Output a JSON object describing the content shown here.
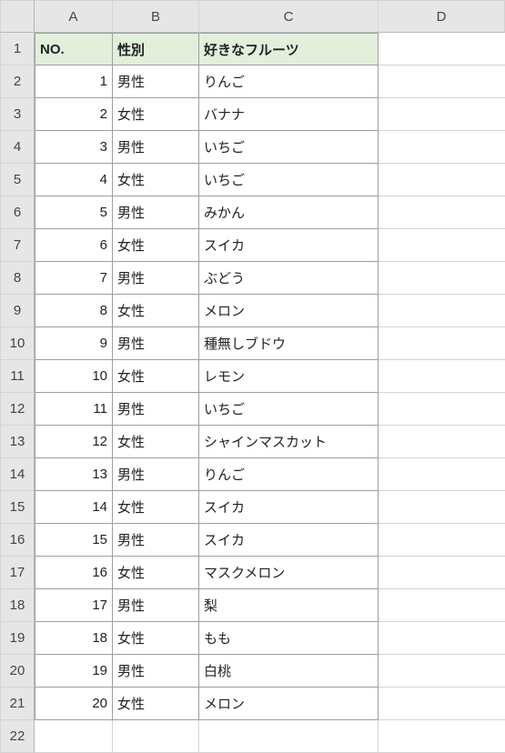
{
  "columns": [
    "A",
    "B",
    "C",
    "D"
  ],
  "headers": [
    "NO.",
    "性別",
    "好きなフルーツ"
  ],
  "rows": [
    {
      "no": 1,
      "gender": "男性",
      "fruit": "りんご"
    },
    {
      "no": 2,
      "gender": "女性",
      "fruit": "バナナ"
    },
    {
      "no": 3,
      "gender": "男性",
      "fruit": "いちご"
    },
    {
      "no": 4,
      "gender": "女性",
      "fruit": "いちご"
    },
    {
      "no": 5,
      "gender": "男性",
      "fruit": "みかん"
    },
    {
      "no": 6,
      "gender": "女性",
      "fruit": "スイカ"
    },
    {
      "no": 7,
      "gender": "男性",
      "fruit": "ぶどう"
    },
    {
      "no": 8,
      "gender": "女性",
      "fruit": "メロン"
    },
    {
      "no": 9,
      "gender": "男性",
      "fruit": "種無しブドウ"
    },
    {
      "no": 10,
      "gender": "女性",
      "fruit": "レモン"
    },
    {
      "no": 11,
      "gender": "男性",
      "fruit": "いちご"
    },
    {
      "no": 12,
      "gender": "女性",
      "fruit": "シャインマスカット"
    },
    {
      "no": 13,
      "gender": "男性",
      "fruit": "りんご"
    },
    {
      "no": 14,
      "gender": "女性",
      "fruit": "スイカ"
    },
    {
      "no": 15,
      "gender": "男性",
      "fruit": "スイカ"
    },
    {
      "no": 16,
      "gender": "女性",
      "fruit": "マスクメロン"
    },
    {
      "no": 17,
      "gender": "男性",
      "fruit": "梨"
    },
    {
      "no": 18,
      "gender": "女性",
      "fruit": "もも"
    },
    {
      "no": 19,
      "gender": "男性",
      "fruit": "白桃"
    },
    {
      "no": 20,
      "gender": "女性",
      "fruit": "メロン"
    }
  ],
  "totalDisplayRows": 22
}
